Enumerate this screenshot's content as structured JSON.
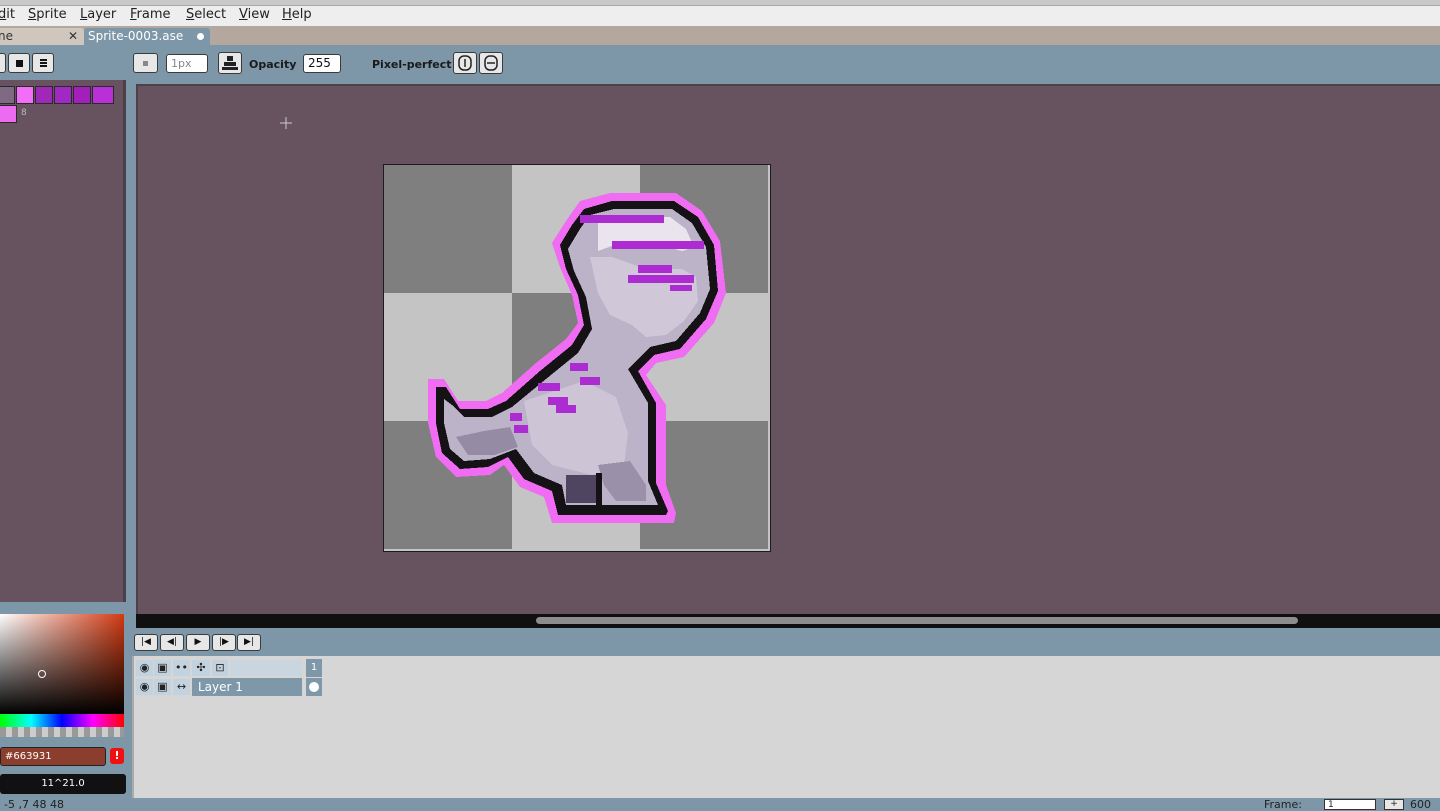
{
  "menu": [
    "dit",
    "Sprite",
    "Layer",
    "Frame",
    "Select",
    "View",
    "Help"
  ],
  "tabs": {
    "home_label": "ne",
    "home_close": "✕",
    "sprite_label": "Sprite-0003.ase"
  },
  "toolbar": {
    "size_value": "1px",
    "opacity_label": "Opacity",
    "opacity_value": "255",
    "pixel_perfect_label": "Pixel-perfect"
  },
  "palette": {
    "colors": [
      "#7e6a82",
      "#f36ef6",
      "#a028b8",
      "#a228c3",
      "#a31fbb",
      "#b830d6"
    ],
    "second_row": [
      "#ec6bf0"
    ],
    "index_label": "8"
  },
  "color_bar": {
    "hex_value": "#663931",
    "warning": "!",
    "index_value": "11^21.0"
  },
  "timeline": {
    "layer_name": "Layer 1",
    "frame_number": "1",
    "header_icons": [
      "eye-icon",
      "lock-icon",
      "link-icon",
      "cel-icon",
      "frame-icon"
    ]
  },
  "status": {
    "coords": "-5 ,7 48 48",
    "frame_label": "Frame:",
    "frame_value": "1",
    "zoom_value": "600"
  },
  "colors": {
    "canvas_bg": "#66535f",
    "accent": "#7d97a8",
    "sprite_outline": "#f070f4",
    "sprite_stripe": "#b02ad0"
  }
}
